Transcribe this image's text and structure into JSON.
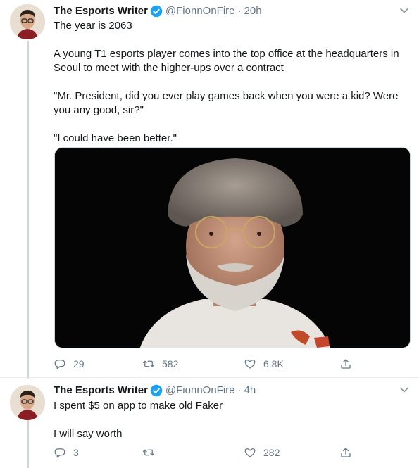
{
  "colors": {
    "text": "#14171a",
    "muted": "#657786",
    "verified": "#1da1f2",
    "divider": "#e6ecf0"
  },
  "tweets": [
    {
      "author": "The Esports Writer",
      "handle": "@FionnOnFire",
      "separator": "·",
      "time": "20h",
      "paragraphs": [
        "The year is 2063",
        "A young T1 esports player comes into the top office at the headquarters in Seoul to meet with the higher-ups over a contract",
        "\"Mr. President, did you ever play games back when you were a kid? Were you any good, sir?\"",
        "\"I could have been better.\""
      ],
      "has_media": true,
      "media_text": "",
      "stats": {
        "replies": "29",
        "retweets": "582",
        "likes": "6.8K"
      }
    },
    {
      "author": "The Esports Writer",
      "handle": "@FionnOnFire",
      "separator": "·",
      "time": "4h",
      "paragraphs": [
        "I spent $5 on app to make old Faker",
        "I will say worth"
      ],
      "has_media": false,
      "stats": {
        "replies": "3",
        "retweets": "",
        "likes": "282"
      }
    }
  ],
  "icons": {
    "verified": "verified-badge-icon",
    "caret": "chevron-down-icon",
    "reply": "reply-icon",
    "retweet": "retweet-icon",
    "like": "heart-icon",
    "share": "share-icon"
  }
}
